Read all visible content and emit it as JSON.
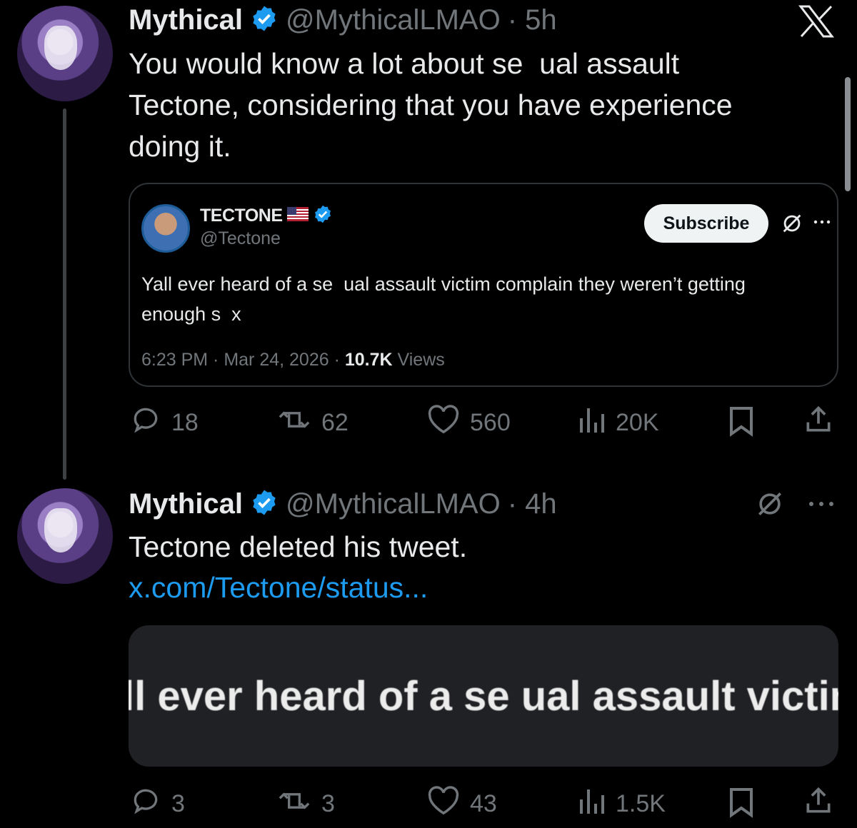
{
  "header": {
    "x_logo": "𝕏"
  },
  "tweets": [
    {
      "author_name": "Mythical",
      "handle": "@MythicalLMAO",
      "time": "· 5h",
      "text_lines": [
        "You would know a lot about se  ual assault",
        "Tectone, considering that you have experience",
        "doing it."
      ],
      "quote": {
        "author_name": "TECTONE",
        "flag": "🇺🇸",
        "handle": "@Tectone",
        "subscribe_label": "Subscribe",
        "text_lines": [
          "Yall ever heard of a se  ual assault victim complain they weren’t getting",
          "enough s  x"
        ],
        "time": "6:23 PM · Mar 24, 2026 ·",
        "views_count": "10.7K",
        "views_label": "Views"
      },
      "actions": {
        "replies": "18",
        "reposts": "62",
        "likes": "560",
        "views": "20K"
      }
    },
    {
      "author_name": "Mythical",
      "handle": "@MythicalLMAO",
      "time": "· 4h",
      "text": "Tectone deleted his tweet.",
      "link": "x.com/Tectone/status...",
      "image_text": "ll ever heard of a se ual assault victim c",
      "actions": {
        "replies": "3",
        "reposts": "3",
        "likes": "43",
        "views": "1.5K"
      }
    }
  ],
  "colors": {
    "accent": "#1d9bf0",
    "muted": "#71767b",
    "background": "#000000"
  },
  "icons": [
    "verified-badge-icon",
    "grok-icon",
    "more-icon",
    "reply-icon",
    "repost-icon",
    "like-icon",
    "views-icon",
    "bookmark-icon",
    "share-icon",
    "x-logo-icon"
  ]
}
